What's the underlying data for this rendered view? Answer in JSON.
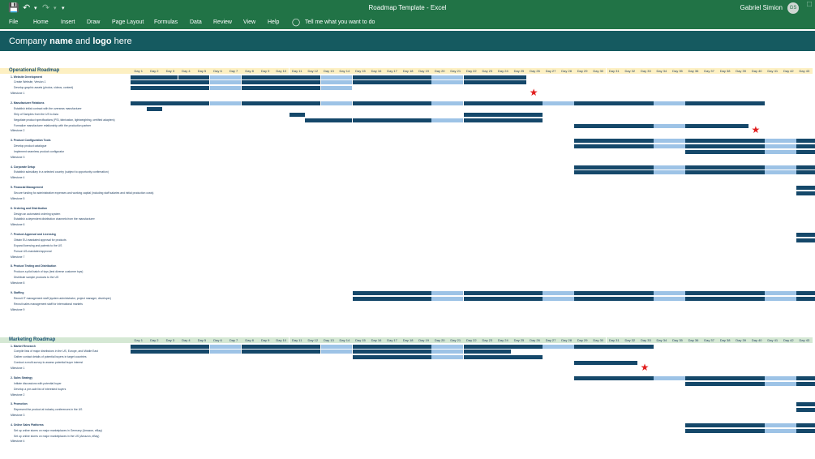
{
  "titlebar": {
    "doc_title": "Roadmap Template",
    "app_name": "Excel",
    "separator": "-",
    "user_name": "Gabriel Simion",
    "user_initials": "GS"
  },
  "ribbon": {
    "tabs": [
      "File",
      "Home",
      "Insert",
      "Draw",
      "Page Layout",
      "Formulas",
      "Data",
      "Review",
      "View",
      "Help"
    ],
    "tell_me": "Tell me what you want to do"
  },
  "header": {
    "company_pre": "Company ",
    "company_name": "name",
    "company_mid": " and ",
    "company_logo": "logo",
    "company_post": " here"
  },
  "days": [
    "Day 1",
    "Day 2",
    "Day 3",
    "Day 4",
    "Day 5",
    "Day 6",
    "Day 7",
    "Day 8",
    "Day 9",
    "Day 10",
    "Day 11",
    "Day 12",
    "Day 13",
    "Day 14",
    "Day 15",
    "Day 16",
    "Day 17",
    "Day 18",
    "Day 19",
    "Day 20",
    "Day 21",
    "Day 22",
    "Day 23",
    "Day 24",
    "Day 25",
    "Day 26",
    "Day 27",
    "Day 28",
    "Day 29",
    "Day 30",
    "Day 31",
    "Day 32",
    "Day 33",
    "Day 34",
    "Day 35",
    "Day 36",
    "Day 37",
    "Day 38",
    "Day 39",
    "Day 40",
    "Day 41",
    "Day 42",
    "Day 43"
  ],
  "sections": [
    {
      "title": "Operational Roadmap",
      "header_color": "#fdf0c2",
      "rows": [
        {
          "type": "cat",
          "label": "1. Website Development",
          "bars": [
            [
              1,
              3,
              "dark"
            ],
            [
              4,
              5,
              "dark"
            ],
            [
              6,
              7,
              "light"
            ],
            [
              8,
              12,
              "dark"
            ],
            [
              13,
              14,
              "light"
            ],
            [
              15,
              19,
              "dark"
            ],
            [
              20,
              21,
              "light"
            ],
            [
              22,
              25,
              "dark"
            ]
          ]
        },
        {
          "type": "task",
          "label": "Create Website, Version 1",
          "bars": [
            [
              1,
              5,
              "dark"
            ],
            [
              6,
              7,
              "light"
            ],
            [
              8,
              12,
              "dark"
            ],
            [
              13,
              14,
              "light"
            ],
            [
              15,
              19,
              "dark"
            ],
            [
              20,
              21,
              "light"
            ],
            [
              22,
              25,
              "dark"
            ]
          ]
        },
        {
          "type": "task",
          "label": "Develop graphic assets (photos, videos, content)",
          "bars": [
            [
              1,
              5,
              "dark"
            ],
            [
              6,
              7,
              "light"
            ],
            [
              8,
              12,
              "dark"
            ],
            [
              13,
              14,
              "light"
            ]
          ]
        },
        {
          "type": "ms",
          "label": "Milestone 1",
          "bars": [],
          "star": 26
        },
        {
          "type": "gap"
        },
        {
          "type": "cat",
          "label": "2. Manufacturer Relations",
          "bars": [
            [
              1,
              5,
              "dark"
            ],
            [
              6,
              7,
              "light"
            ],
            [
              8,
              12,
              "dark"
            ],
            [
              13,
              14,
              "light"
            ],
            [
              15,
              19,
              "dark"
            ],
            [
              20,
              21,
              "light"
            ],
            [
              22,
              26,
              "dark"
            ],
            [
              27,
              28,
              "light"
            ],
            [
              29,
              33,
              "dark"
            ],
            [
              34,
              35,
              "light"
            ],
            [
              36,
              40,
              "dark"
            ]
          ]
        },
        {
          "type": "task",
          "label": "Establish initial contract with the overseas manufacturer",
          "bars": [
            [
              2,
              2,
              "dark"
            ]
          ]
        },
        {
          "type": "task",
          "label": "Ship of Samples from the US to Asia",
          "bars": [
            [
              11,
              11,
              "dark"
            ],
            [
              22,
              26,
              "dark"
            ]
          ]
        },
        {
          "type": "task",
          "label": "Negotiate product specifications (PSI, fabrication, lightweighting, certified adapters)",
          "bars": [
            [
              12,
              14,
              "dark"
            ],
            [
              15,
              19,
              "dark"
            ],
            [
              20,
              21,
              "light"
            ],
            [
              22,
              26,
              "dark"
            ]
          ]
        },
        {
          "type": "task",
          "label": "Formalize manufacturer relationship with the production partner",
          "bars": [
            [
              29,
              33,
              "dark"
            ],
            [
              34,
              35,
              "light"
            ],
            [
              36,
              39,
              "dark"
            ]
          ]
        },
        {
          "type": "ms",
          "label": "Milestone 2",
          "bars": [],
          "star": 40
        },
        {
          "type": "gap"
        },
        {
          "type": "cat",
          "label": "3. Product Configuration Tools",
          "bars": [
            [
              29,
              33,
              "dark"
            ],
            [
              34,
              35,
              "light"
            ],
            [
              36,
              40,
              "dark"
            ],
            [
              41,
              42,
              "light"
            ],
            [
              43,
              44,
              "dark"
            ]
          ]
        },
        {
          "type": "task",
          "label": "Develop product catalogue",
          "bars": [
            [
              29,
              33,
              "dark"
            ],
            [
              34,
              35,
              "light"
            ],
            [
              36,
              40,
              "dark"
            ],
            [
              41,
              42,
              "light"
            ],
            [
              43,
              44,
              "dark"
            ]
          ]
        },
        {
          "type": "task",
          "label": "Implement seamless product configurator",
          "bars": [
            [
              36,
              40,
              "dark"
            ],
            [
              41,
              42,
              "light"
            ],
            [
              43,
              44,
              "dark"
            ]
          ]
        },
        {
          "type": "ms",
          "label": "Milestone 3",
          "bars": []
        },
        {
          "type": "gap"
        },
        {
          "type": "cat",
          "label": "4. Corporate Setup",
          "bars": [
            [
              29,
              33,
              "dark"
            ],
            [
              34,
              35,
              "light"
            ],
            [
              36,
              40,
              "dark"
            ],
            [
              41,
              42,
              "light"
            ],
            [
              43,
              44,
              "dark"
            ]
          ]
        },
        {
          "type": "task",
          "label": "Establish subsidiary in a selected country (subject to opportunity confirmation)",
          "bars": [
            [
              29,
              33,
              "dark"
            ],
            [
              34,
              35,
              "light"
            ],
            [
              36,
              40,
              "dark"
            ],
            [
              41,
              42,
              "light"
            ],
            [
              43,
              44,
              "dark"
            ]
          ]
        },
        {
          "type": "ms",
          "label": "Milestone 4",
          "bars": []
        },
        {
          "type": "gap"
        },
        {
          "type": "cat",
          "label": "5. Financial Management",
          "bars": [
            [
              43,
              44,
              "dark"
            ]
          ]
        },
        {
          "type": "task",
          "label": "Secure funding for administrative expenses and working capital (including staff salaries and initial production costs)",
          "bars": [
            [
              43,
              44,
              "dark"
            ]
          ]
        },
        {
          "type": "ms",
          "label": "Milestone 5",
          "bars": []
        },
        {
          "type": "gap"
        },
        {
          "type": "cat",
          "label": "6. Ordering and Distribution",
          "bars": []
        },
        {
          "type": "task",
          "label": "Design an automated ordering system",
          "bars": []
        },
        {
          "type": "task",
          "label": "Establish a dependent distribution channels from the manufacturer",
          "bars": []
        },
        {
          "type": "ms",
          "label": "Milestone 6",
          "bars": []
        },
        {
          "type": "gap"
        },
        {
          "type": "cat",
          "label": "7. Product Approval and Licensing",
          "bars": [
            [
              43,
              44,
              "dark"
            ]
          ]
        },
        {
          "type": "task",
          "label": "Obtain EU-mandated approval for products",
          "bars": [
            [
              43,
              44,
              "dark"
            ]
          ]
        },
        {
          "type": "task",
          "label": "Expand licensing and patents to the US",
          "bars": []
        },
        {
          "type": "task",
          "label": "Pursue US-mandated approval",
          "bars": []
        },
        {
          "type": "ms",
          "label": "Milestone 7",
          "bars": []
        },
        {
          "type": "gap"
        },
        {
          "type": "cat",
          "label": "8. Product Testing and Distribution",
          "bars": []
        },
        {
          "type": "task",
          "label": "Produce a pilot batch of toys (test diverse customer toys)",
          "bars": []
        },
        {
          "type": "task",
          "label": "Distribute sample products to the US",
          "bars": []
        },
        {
          "type": "ms",
          "label": "Milestone 8",
          "bars": []
        },
        {
          "type": "gap"
        },
        {
          "type": "cat",
          "label": "9. Staffing",
          "bars": [
            [
              15,
              19,
              "dark"
            ],
            [
              20,
              21,
              "light"
            ],
            [
              22,
              26,
              "dark"
            ],
            [
              27,
              28,
              "light"
            ],
            [
              29,
              33,
              "dark"
            ],
            [
              34,
              35,
              "light"
            ],
            [
              36,
              40,
              "dark"
            ],
            [
              41,
              42,
              "light"
            ],
            [
              43,
              44,
              "dark"
            ]
          ]
        },
        {
          "type": "task",
          "label": "Recruit IT management staff (system administrator, project manager, developer)",
          "bars": [
            [
              15,
              19,
              "dark"
            ],
            [
              20,
              21,
              "light"
            ],
            [
              22,
              26,
              "dark"
            ],
            [
              27,
              28,
              "light"
            ],
            [
              29,
              33,
              "dark"
            ],
            [
              34,
              35,
              "light"
            ],
            [
              36,
              40,
              "dark"
            ],
            [
              41,
              42,
              "light"
            ],
            [
              43,
              44,
              "dark"
            ]
          ]
        },
        {
          "type": "task",
          "label": "Recruit sales management staff for international markets",
          "bars": []
        },
        {
          "type": "ms",
          "label": "Milestone 9",
          "bars": []
        }
      ]
    },
    {
      "title": "Marketing Roadmap",
      "header_color": "#d5e8d4",
      "rows": [
        {
          "type": "cat",
          "label": "1. Market Research",
          "bars": [
            [
              1,
              5,
              "dark"
            ],
            [
              6,
              7,
              "light"
            ],
            [
              8,
              12,
              "dark"
            ],
            [
              13,
              14,
              "light"
            ],
            [
              15,
              19,
              "dark"
            ],
            [
              20,
              21,
              "light"
            ],
            [
              22,
              26,
              "dark"
            ],
            [
              27,
              28,
              "light"
            ],
            [
              29,
              33,
              "dark"
            ]
          ]
        },
        {
          "type": "task",
          "label": "Compile lists of major distributors in the US, Europe, and Middle East",
          "bars": [
            [
              1,
              5,
              "dark"
            ],
            [
              6,
              7,
              "light"
            ],
            [
              8,
              12,
              "dark"
            ],
            [
              13,
              14,
              "light"
            ],
            [
              15,
              19,
              "dark"
            ],
            [
              20,
              21,
              "light"
            ],
            [
              22,
              24,
              "dark"
            ]
          ]
        },
        {
          "type": "task",
          "label": "Gather contact details of potential buyers in target countries",
          "bars": [
            [
              15,
              19,
              "dark"
            ],
            [
              20,
              21,
              "light"
            ],
            [
              22,
              26,
              "dark"
            ]
          ]
        },
        {
          "type": "task",
          "label": "Conduct a multi-survey to assess potential buyer interest",
          "bars": [
            [
              29,
              32,
              "dark"
            ]
          ]
        },
        {
          "type": "ms",
          "label": "Milestone 1",
          "bars": [],
          "star": 33
        },
        {
          "type": "gap"
        },
        {
          "type": "cat",
          "label": "2. Sales Strategy",
          "bars": [
            [
              29,
              33,
              "dark"
            ],
            [
              34,
              35,
              "light"
            ],
            [
              36,
              40,
              "dark"
            ],
            [
              41,
              42,
              "light"
            ],
            [
              43,
              44,
              "dark"
            ]
          ]
        },
        {
          "type": "task",
          "label": "Initiate discussions with potential buyer",
          "bars": [
            [
              36,
              40,
              "dark"
            ],
            [
              41,
              42,
              "light"
            ],
            [
              43,
              44,
              "dark"
            ]
          ]
        },
        {
          "type": "task",
          "label": "Develop a pre-sale list of interested buyers",
          "bars": []
        },
        {
          "type": "ms",
          "label": "Milestone 2",
          "bars": []
        },
        {
          "type": "gap"
        },
        {
          "type": "cat",
          "label": "3. Promotion",
          "bars": [
            [
              43,
              44,
              "dark"
            ]
          ]
        },
        {
          "type": "task",
          "label": "Represent the product at industry conferences in the US",
          "bars": [
            [
              43,
              44,
              "dark"
            ]
          ]
        },
        {
          "type": "ms",
          "label": "Milestone 3",
          "bars": []
        },
        {
          "type": "gap"
        },
        {
          "type": "cat",
          "label": "4. Online Sales Platforms",
          "bars": [
            [
              36,
              40,
              "dark"
            ],
            [
              41,
              42,
              "light"
            ],
            [
              43,
              44,
              "dark"
            ]
          ]
        },
        {
          "type": "task",
          "label": "Set up online stores on major marketplaces in Germany (Amazon, eBay)",
          "bars": [
            [
              36,
              40,
              "dark"
            ],
            [
              41,
              42,
              "light"
            ],
            [
              43,
              44,
              "dark"
            ]
          ]
        },
        {
          "type": "task",
          "label": "Set up online stores on major marketplaces in the US (Amazon, eBay)",
          "bars": []
        },
        {
          "type": "ms",
          "label": "Milestone 4",
          "bars": []
        }
      ]
    }
  ]
}
